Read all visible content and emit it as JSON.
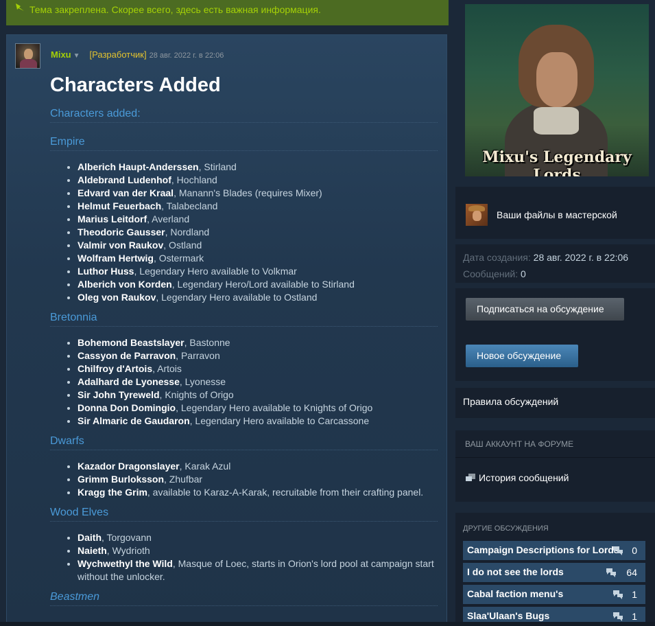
{
  "pinned_notice": "Тема закреплена. Скорее всего, здесь есть важная информация.",
  "post": {
    "author": "Mixu",
    "role_badge": "[Разработчик]",
    "date": "28 авг. 2022 г. в 22:06",
    "title": "Characters Added",
    "intro_heading": "Characters added:",
    "sections": [
      {
        "heading": "Empire",
        "items": [
          {
            "name": "Alberich Haupt-Anderssen",
            "rest": ", Stirland"
          },
          {
            "name": "Aldebrand Ludenhof",
            "rest": ", Hochland"
          },
          {
            "name": "Edvard van der Kraal",
            "rest": ", Manann's Blades (requires Mixer)"
          },
          {
            "name": "Helmut Feuerbach",
            "rest": ", Talabecland"
          },
          {
            "name": "Marius Leitdorf",
            "rest": ", Averland"
          },
          {
            "name": "Theodoric Gausser",
            "rest": ", Nordland"
          },
          {
            "name": "Valmir von Raukov",
            "rest": ", Ostland"
          },
          {
            "name": "Wolfram Hertwig",
            "rest": ", Ostermark"
          },
          {
            "name": "Luthor Huss",
            "rest": ", Legendary Hero available to Volkmar"
          },
          {
            "name": "Alberich von Korden",
            "rest": ", Legendary Hero/Lord available to Stirland"
          },
          {
            "name": "Oleg von Raukov",
            "rest": ", Legendary Hero available to Ostland"
          }
        ]
      },
      {
        "heading": "Bretonnia",
        "items": [
          {
            "name": "Bohemond Beastslayer",
            "rest": ", Bastonne"
          },
          {
            "name": "Cassyon de Parravon",
            "rest": ", Parravon"
          },
          {
            "name": "Chilfroy d'Artois",
            "rest": ", Artois"
          },
          {
            "name": "Adalhard de Lyonesse",
            "rest": ", Lyonesse"
          },
          {
            "name": "Sir John Tyreweld",
            "rest": ", Knights of Origo"
          },
          {
            "name": "Donna Don Domingio",
            "rest": ", Legendary Hero available to Knights of Origo"
          },
          {
            "name": "Sir Almaric de Gaudaron",
            "rest": ", Legendary Hero available to Carcassone"
          }
        ]
      },
      {
        "heading": "Dwarfs",
        "items": [
          {
            "name": "Kazador Dragonslayer",
            "rest": ", Karak Azul"
          },
          {
            "name": "Grimm Burloksson",
            "rest": ", Zhufbar"
          },
          {
            "name": "Kragg the Grim",
            "rest": ", available to Karaz-A-Karak, recruitable from their crafting panel."
          }
        ]
      },
      {
        "heading": "Wood Elves",
        "items": [
          {
            "name": "Daith",
            "rest": ", Torgovann"
          },
          {
            "name": "Naieth",
            "rest": ", Wydrioth"
          },
          {
            "name": "Wychwethyl the Wild",
            "rest": ", Masque of Loec, starts in Orion's lord pool at campaign start without the unlocker."
          }
        ]
      },
      {
        "heading": "Beastmen",
        "items": []
      }
    ]
  },
  "sidebar": {
    "banner_title": "Mixu's Legendary Lords",
    "workshop_link": "Ваши файлы в мастерской",
    "created_label": "Дата создания:",
    "created_value": "28 авг. 2022 г. в 22:06",
    "messages_label": "Сообщений:",
    "messages_value": "0",
    "subscribe_button": "Подписаться на обсуждение",
    "new_discussion_button": "Новое обсуждение",
    "rules_link": "Правила обсуждений",
    "account_heading": "ВАШ АККАУНТ НА ФОРУМЕ",
    "history_link": "История сообщений",
    "other_heading": "ДРУГИЕ ОБСУЖДЕНИЯ",
    "other_discussions": [
      {
        "title": "Campaign Descriptions for Lords",
        "count": "0"
      },
      {
        "title": "I do not see the lords",
        "count": "64"
      },
      {
        "title": "Cabal faction menu's",
        "count": "1"
      },
      {
        "title": "Slaa'Ulaan's Bugs",
        "count": "1"
      }
    ]
  },
  "colors": {
    "background": "#1b2838",
    "pinned_bg": "#4c6b22",
    "pinned_text": "#a4d007",
    "heading_blue": "#4a9ad8",
    "author_green": "#a4d007",
    "dev_badge": "#e4c32f"
  }
}
